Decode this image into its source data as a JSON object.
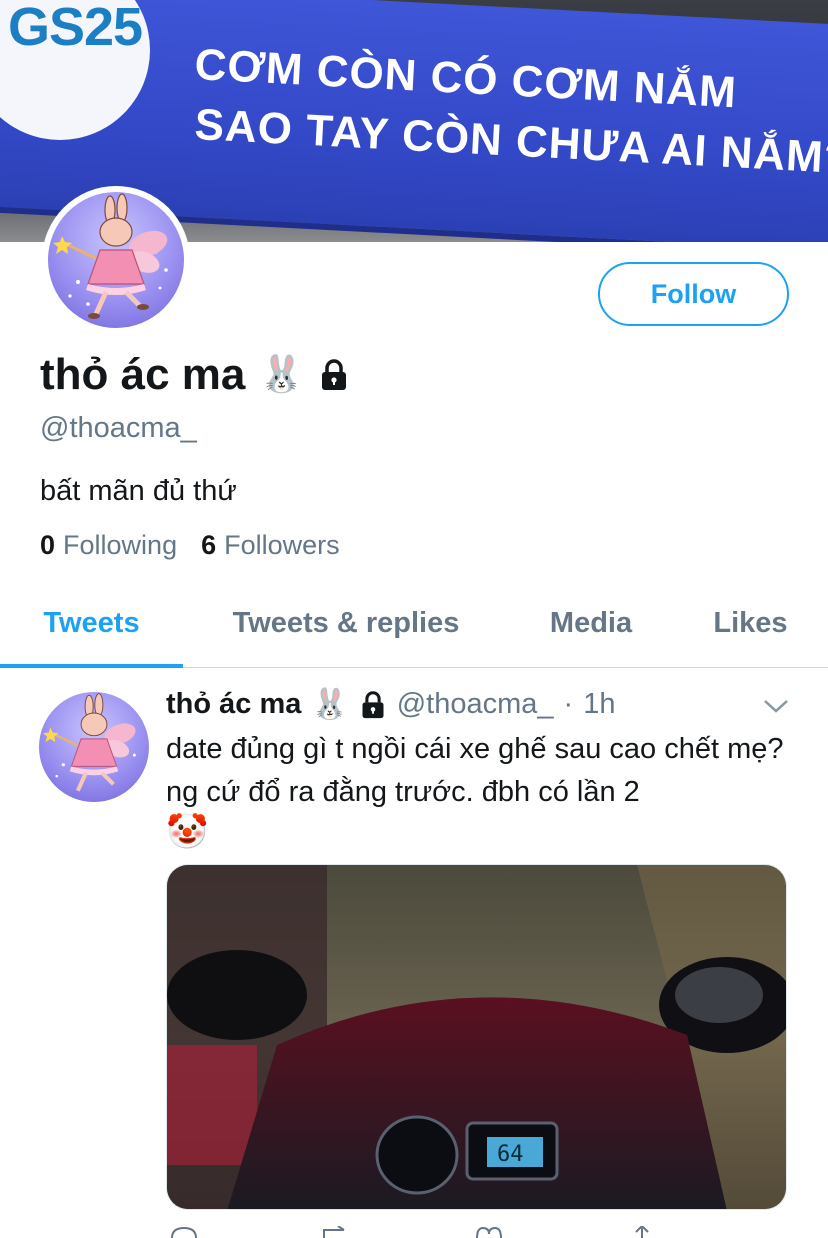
{
  "banner": {
    "logo": "GS25",
    "line1": "CƠM CÒN CÓ CƠM NẮM",
    "line2": "SAO TAY CÒN CHƯA AI NẮM?"
  },
  "profile": {
    "display_name": "thỏ ác ma",
    "name_emoji": "🐰",
    "handle": "@thoacma_",
    "bio": "bất mãn đủ thứ",
    "following_count": "0",
    "following_label": "Following",
    "followers_count": "6",
    "followers_label": "Followers",
    "follow_button": "Follow"
  },
  "tabs": [
    {
      "label": "Tweets",
      "active": true
    },
    {
      "label": "Tweets & replies",
      "active": false
    },
    {
      "label": "Media",
      "active": false
    },
    {
      "label": "Likes",
      "active": false
    }
  ],
  "tweet": {
    "author_name": "thỏ ác ma",
    "author_emoji": "🐰",
    "author_handle": "@thoacma_",
    "separator": "·",
    "time": "1h",
    "text": "date đủng gì t ngồi cái xe ghế sau cao chết mẹ? ng cứ đổ ra đằng trước. đbh có lần 2",
    "trailing_emoji": "🤡",
    "media_speed": "64"
  },
  "colors": {
    "accent": "#1da1f2",
    "secondary_text": "#657786",
    "primary_text": "#14171a",
    "banner_blue": "#3349c8"
  },
  "icons": {
    "lock": "lock-icon",
    "chevron": "chevron-down-icon",
    "reply": "reply-icon",
    "retweet": "retweet-icon",
    "like": "like-icon",
    "share": "share-icon"
  }
}
